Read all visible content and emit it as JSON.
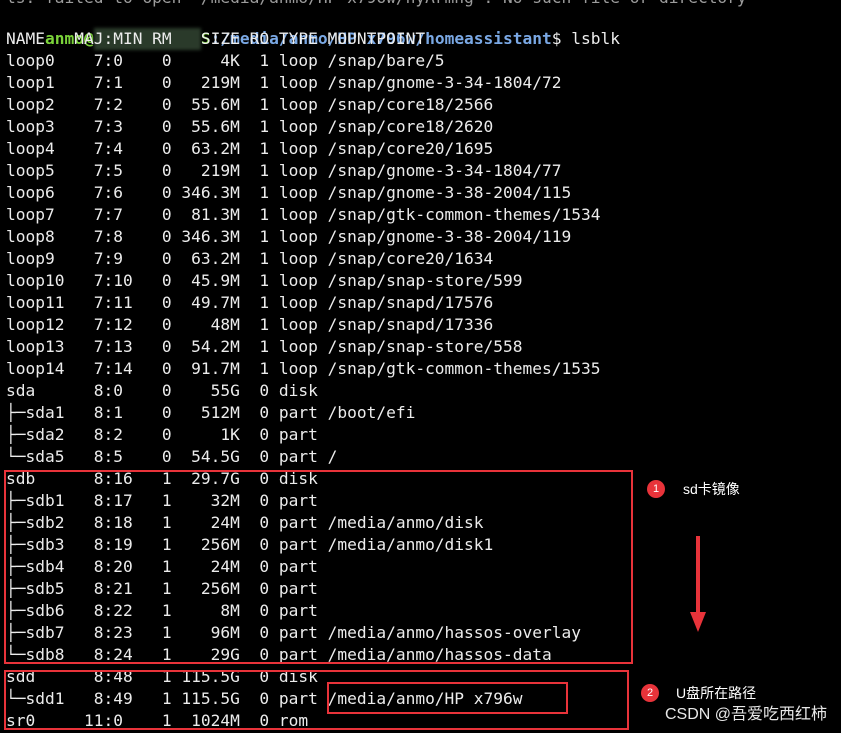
{
  "terminal": {
    "top_partial": "ls: failed to open '/media/anmo/HP x796w/hyArmhg': No such file or directory",
    "prompt_user": "anmo@",
    "prompt_host": "S",
    "prompt_path": ":/media/anmo/HP x796w/homeassistant",
    "prompt_symbol": "$ ",
    "command": "lsblk",
    "header": "NAME   MAJ:MIN RM   SIZE RO TYPE MOUNTPOINT",
    "rows": [
      "loop0    7:0    0     4K  1 loop /snap/bare/5",
      "loop1    7:1    0   219M  1 loop /snap/gnome-3-34-1804/72",
      "loop2    7:2    0  55.6M  1 loop /snap/core18/2566",
      "loop3    7:3    0  55.6M  1 loop /snap/core18/2620",
      "loop4    7:4    0  63.2M  1 loop /snap/core20/1695",
      "loop5    7:5    0   219M  1 loop /snap/gnome-3-34-1804/77",
      "loop6    7:6    0 346.3M  1 loop /snap/gnome-3-38-2004/115",
      "loop7    7:7    0  81.3M  1 loop /snap/gtk-common-themes/1534",
      "loop8    7:8    0 346.3M  1 loop /snap/gnome-3-38-2004/119",
      "loop9    7:9    0  63.2M  1 loop /snap/core20/1634",
      "loop10   7:10   0  45.9M  1 loop /snap/snap-store/599",
      "loop11   7:11   0  49.7M  1 loop /snap/snapd/17576",
      "loop12   7:12   0    48M  1 loop /snap/snapd/17336",
      "loop13   7:13   0  54.2M  1 loop /snap/snap-store/558",
      "loop14   7:14   0  91.7M  1 loop /snap/gtk-common-themes/1535",
      "sda      8:0    0    55G  0 disk",
      "├─sda1   8:1    0   512M  0 part /boot/efi",
      "├─sda2   8:2    0     1K  0 part",
      "└─sda5   8:5    0  54.5G  0 part /",
      "sdb      8:16   1  29.7G  0 disk",
      "├─sdb1   8:17   1    32M  0 part",
      "├─sdb2   8:18   1    24M  0 part /media/anmo/disk",
      "├─sdb3   8:19   1   256M  0 part /media/anmo/disk1",
      "├─sdb4   8:20   1    24M  0 part",
      "├─sdb5   8:21   1   256M  0 part",
      "├─sdb6   8:22   1     8M  0 part",
      "├─sdb7   8:23   1    96M  0 part /media/anmo/hassos-overlay",
      "└─sdb8   8:24   1    29G  0 part /media/anmo/hassos-data",
      "sdd      8:48   1 115.5G  0 disk",
      "└─sdd1   8:49   1 115.5G  0 part /media/anmo/HP x796w",
      "sr0     11:0    1  1024M  0 rom"
    ]
  },
  "annotations": {
    "badge1": "1",
    "note1": "sd卡镜像",
    "badge2": "2",
    "note2": "U盘所在路径",
    "accent_color": "#e8333a"
  },
  "watermark": "CSDN @吾爱吃西红柿"
}
